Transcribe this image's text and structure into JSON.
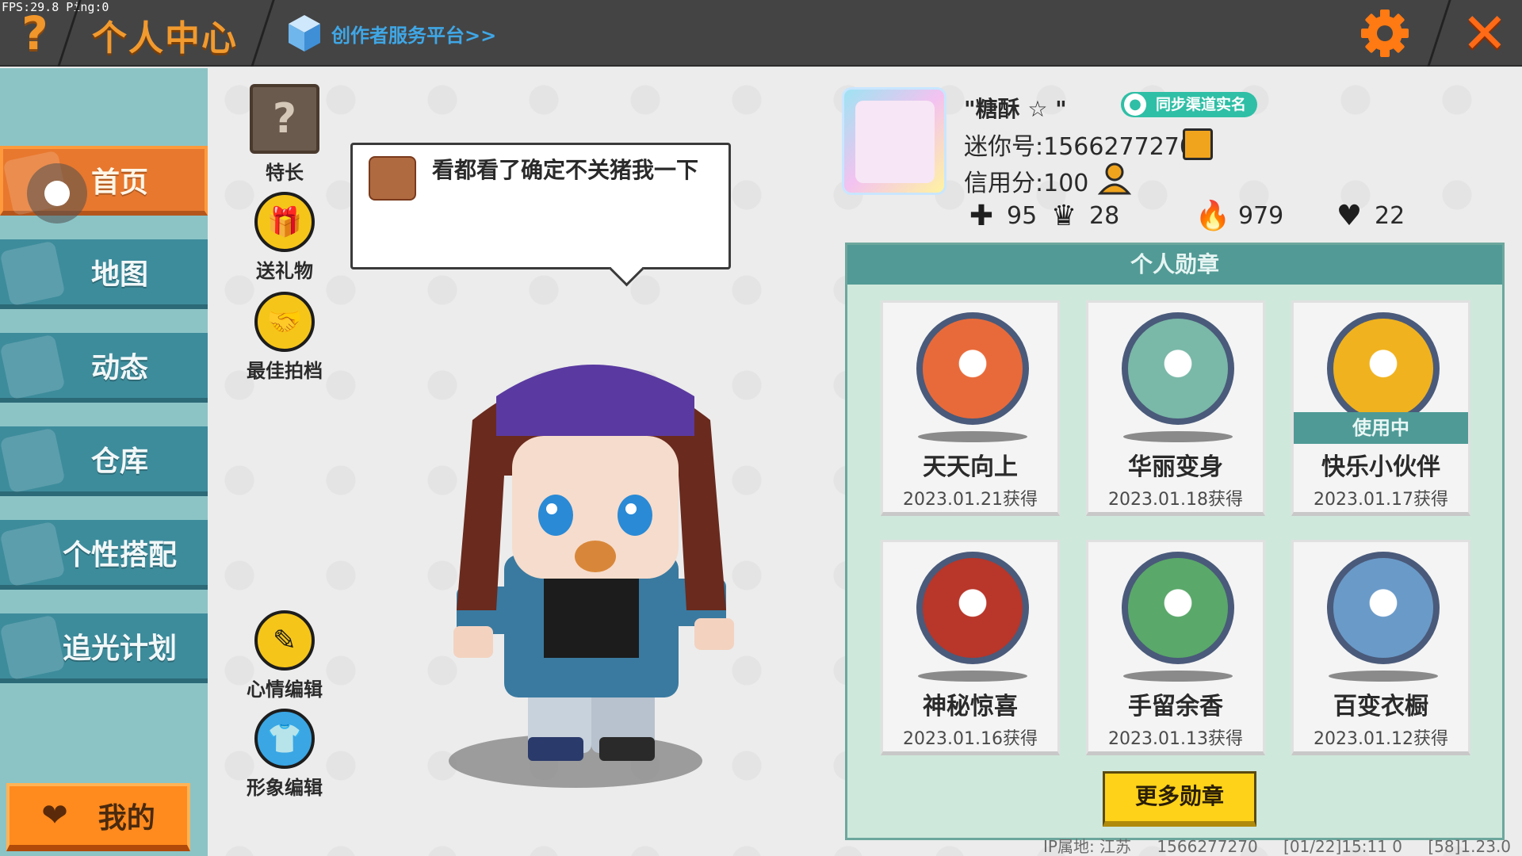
{
  "debug": {
    "fps": "FPS:29.8",
    "ping": "Ping:0"
  },
  "header": {
    "title": "个人中心",
    "creator_link": "创作者服务平台>>",
    "help_icon": "question-icon",
    "settings_icon": "gear-icon",
    "close_icon": "close-icon"
  },
  "sidebar": {
    "items": [
      {
        "label": "首页",
        "active": true
      },
      {
        "label": "地图",
        "active": false
      },
      {
        "label": "动态",
        "active": false
      },
      {
        "label": "仓库",
        "active": false
      },
      {
        "label": "个性搭配",
        "active": false
      },
      {
        "label": "追光计划",
        "active": false
      }
    ],
    "mine_label": "我的"
  },
  "actions": [
    {
      "label": "特长",
      "icon": "question-box-icon"
    },
    {
      "label": "送礼物",
      "icon": "gift-icon"
    },
    {
      "label": "最佳拍档",
      "icon": "handshake-icon"
    },
    {
      "label": "心情编辑",
      "icon": "edit-icon"
    },
    {
      "label": "形象编辑",
      "icon": "outfit-icon"
    }
  ],
  "mood_bubble": {
    "text": "看都看了确定不关猪我一下"
  },
  "profile": {
    "nickname": "\"糖酥 ☆ \"",
    "sync_badge": "同步渠道实名",
    "mini_id": "迷你号:1566277270",
    "credit": "信用分:100",
    "stats": [
      {
        "icon": "plus-flag-icon",
        "value": "95"
      },
      {
        "icon": "fans-icon",
        "value": "28"
      },
      {
        "icon": "flame-icon",
        "value": "979"
      },
      {
        "icon": "heart-icon",
        "value": "22"
      }
    ]
  },
  "medals": {
    "header": "个人勋章",
    "in_use_label": "使用中",
    "items": [
      {
        "name": "天天向上",
        "date": "2023.01.21获得",
        "in_use": false,
        "color": "#e86a3a"
      },
      {
        "name": "华丽变身",
        "date": "2023.01.18获得",
        "in_use": false,
        "color": "#7ab8a8"
      },
      {
        "name": "快乐小伙伴",
        "date": "2023.01.17获得",
        "in_use": true,
        "color": "#f0b21e"
      },
      {
        "name": "神秘惊喜",
        "date": "2023.01.16获得",
        "in_use": false,
        "color": "#b8362a"
      },
      {
        "name": "手留余香",
        "date": "2023.01.13获得",
        "in_use": false,
        "color": "#5aa86a"
      },
      {
        "name": "百变衣橱",
        "date": "2023.01.12获得",
        "in_use": false,
        "color": "#6a9ac8"
      }
    ],
    "more_button": "更多勋章"
  },
  "footer": {
    "ip_location": "IP属地: 江苏",
    "uid": "1566277270",
    "time": "[01/22]15:11 0",
    "version": "[58]1.23.0"
  }
}
